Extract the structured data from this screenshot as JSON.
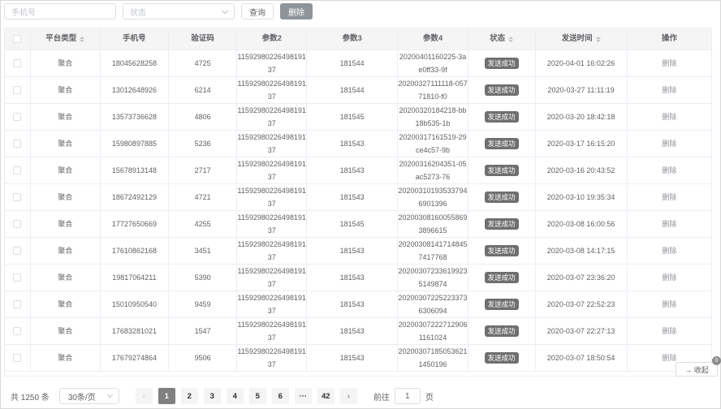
{
  "toolbar": {
    "phone_placeholder": "手机号",
    "status_placeholder": "状态",
    "query_label": "查询",
    "delete_label": "删除"
  },
  "table": {
    "headers": [
      "平台类型",
      "手机号",
      "验证码",
      "参数2",
      "参数3",
      "参数4",
      "状态",
      "发送时间",
      "操作"
    ],
    "rows": [
      {
        "platform": "聚合",
        "phone": "18045628258",
        "code": "4725",
        "p2": "1159298022649819137",
        "p3": "181544",
        "p4": "20200401160225-3ae0ff33-9f",
        "status": "发送成功",
        "time": "2020-04-01 16:02:26",
        "action": "删除"
      },
      {
        "platform": "聚合",
        "phone": "13012648926",
        "code": "6214",
        "p2": "1159298022649819137",
        "p3": "181544",
        "p4": "20200327111118-05771810-f0",
        "status": "发送成功",
        "time": "2020-03-27 11:11:19",
        "action": "删除"
      },
      {
        "platform": "聚合",
        "phone": "13573736628",
        "code": "4806",
        "p2": "1159298022649819137",
        "p3": "181545",
        "p4": "20200320184218-bb18b535-1b",
        "status": "发送成功",
        "time": "2020-03-20 18:42:18",
        "action": "删除"
      },
      {
        "platform": "聚合",
        "phone": "15980897885",
        "code": "5236",
        "p2": "1159298022649819137",
        "p3": "181543",
        "p4": "20200317161519-29ce4c57-9b",
        "status": "发送成功",
        "time": "2020-03-17 16:15:20",
        "action": "删除"
      },
      {
        "platform": "聚合",
        "phone": "15678913148",
        "code": "2717",
        "p2": "1159298022649819137",
        "p3": "181543",
        "p4": "20200316204351-05ac5273-76",
        "status": "发送成功",
        "time": "2020-03-16 20:43:52",
        "action": "删除"
      },
      {
        "platform": "聚合",
        "phone": "18672492129",
        "code": "4721",
        "p2": "1159298022649819137",
        "p3": "181543",
        "p4": "202003101935337946901396",
        "status": "发送成功",
        "time": "2020-03-10 19:35:34",
        "action": "删除"
      },
      {
        "platform": "聚合",
        "phone": "17727650669",
        "code": "4255",
        "p2": "1159298022649819137",
        "p3": "181545",
        "p4": "202003081600558693896615",
        "status": "发送成功",
        "time": "2020-03-08 16:00:56",
        "action": "删除"
      },
      {
        "platform": "聚合",
        "phone": "17610862168",
        "code": "3451",
        "p2": "1159298022649819137",
        "p3": "181543",
        "p4": "202003081417148457417768",
        "status": "发送成功",
        "time": "2020-03-08 14:17:15",
        "action": "删除"
      },
      {
        "platform": "聚合",
        "phone": "19817064211",
        "code": "5390",
        "p2": "1159298022649819137",
        "p3": "181543",
        "p4": "202003072336199235149874",
        "status": "发送成功",
        "time": "2020-03-07 23:36:20",
        "action": "删除"
      },
      {
        "platform": "聚合",
        "phone": "15010950540",
        "code": "9459",
        "p2": "1159298022649819137",
        "p3": "181543",
        "p4": "202003072252233736306094",
        "status": "发送成功",
        "time": "2020-03-07 22:52:23",
        "action": "删除"
      },
      {
        "platform": "聚合",
        "phone": "17683281021",
        "code": "1547",
        "p2": "1159298022649819137",
        "p3": "181543",
        "p4": "202003072227129061161024",
        "status": "发送成功",
        "time": "2020-03-07 22:27:13",
        "action": "删除"
      },
      {
        "platform": "聚合",
        "phone": "17679274864",
        "code": "9506",
        "p2": "1159298022649819137",
        "p3": "181543",
        "p4": "202003071850536211450196",
        "status": "发送成功",
        "time": "2020-03-07 18:50:54",
        "action": "删除"
      }
    ]
  },
  "pagination": {
    "total": "共 1250 条",
    "page_size": "30条/页",
    "pages": [
      "1",
      "2",
      "3",
      "4",
      "5",
      "6",
      "···",
      "42"
    ],
    "active_page": "1",
    "goto_prefix": "前往",
    "goto_value": "1",
    "goto_suffix": "页"
  },
  "collapse_label": "→ 收起",
  "corner_badge": "0"
}
